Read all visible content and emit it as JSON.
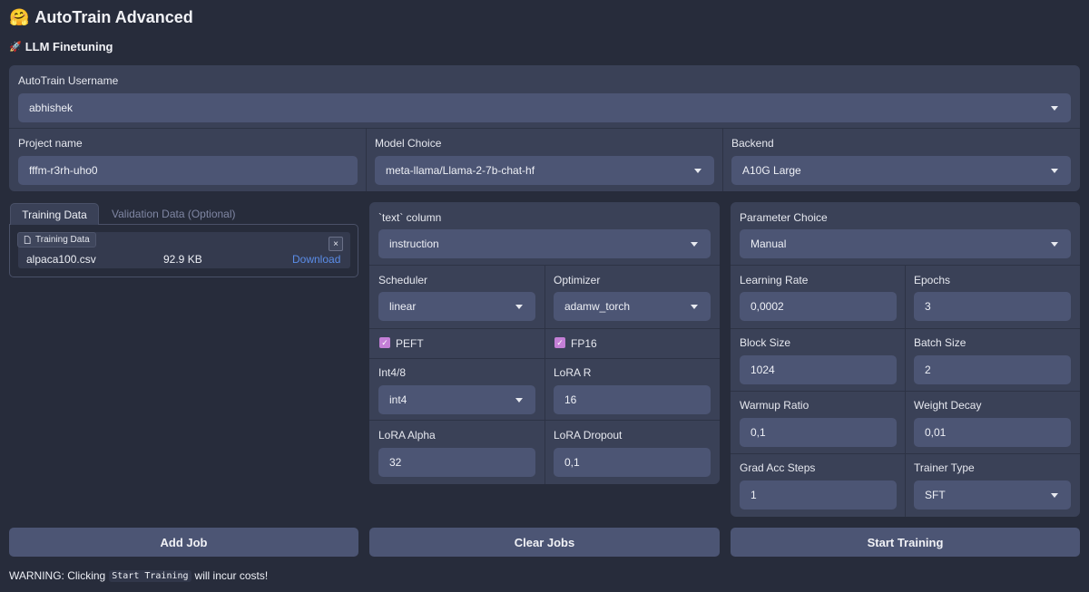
{
  "header": {
    "title_emoji": "🤗",
    "title": "AutoTrain Advanced",
    "subtitle_emoji": "🚀",
    "subtitle": "LLM Finetuning"
  },
  "top": {
    "username_label": "AutoTrain Username",
    "username_value": "abhishek",
    "project_label": "Project name",
    "project_value": "fffm-r3rh-uho0",
    "model_label": "Model Choice",
    "model_value": "meta-llama/Llama-2-7b-chat-hf",
    "backend_label": "Backend",
    "backend_value": "A10G Large"
  },
  "data_tabs": {
    "tabs": [
      "Training Data",
      "Validation Data (Optional)"
    ],
    "file_chip_label": "Training Data",
    "file_name": "alpaca100.csv",
    "file_size": "92.9 KB",
    "download_label": "Download",
    "close_icon": "×"
  },
  "middle": {
    "text_column_label": "`text` column",
    "text_column_value": "instruction",
    "scheduler_label": "Scheduler",
    "scheduler_value": "linear",
    "optimizer_label": "Optimizer",
    "optimizer_value": "adamw_torch",
    "peft_label": "PEFT",
    "fp16_label": "FP16",
    "int_label": "Int4/8",
    "int_value": "int4",
    "lora_r_label": "LoRA R",
    "lora_r_value": "16",
    "lora_alpha_label": "LoRA Alpha",
    "lora_alpha_value": "32",
    "lora_dropout_label": "LoRA Dropout",
    "lora_dropout_value": "0,1"
  },
  "params": {
    "parameter_choice_label": "Parameter Choice",
    "parameter_choice_value": "Manual",
    "lr_label": "Learning Rate",
    "lr_value": "0,0002",
    "epochs_label": "Epochs",
    "epochs_value": "3",
    "block_size_label": "Block Size",
    "block_size_value": "1024",
    "batch_size_label": "Batch Size",
    "batch_size_value": "2",
    "warmup_label": "Warmup Ratio",
    "warmup_value": "0,1",
    "weight_decay_label": "Weight Decay",
    "weight_decay_value": "0,01",
    "grad_acc_label": "Grad Acc Steps",
    "grad_acc_value": "1",
    "trainer_label": "Trainer Type",
    "trainer_value": "SFT"
  },
  "actions": {
    "add_job": "Add Job",
    "clear_jobs": "Clear Jobs",
    "start_training": "Start Training"
  },
  "warning": {
    "prefix": "WARNING: Clicking",
    "code": "Start Training",
    "suffix": "will incur costs!"
  },
  "colors": {
    "background": "#272c3b",
    "panel": "#3a4157",
    "field": "#4c5574",
    "checkbox": "#c47fd6",
    "link": "#5b8de8"
  }
}
